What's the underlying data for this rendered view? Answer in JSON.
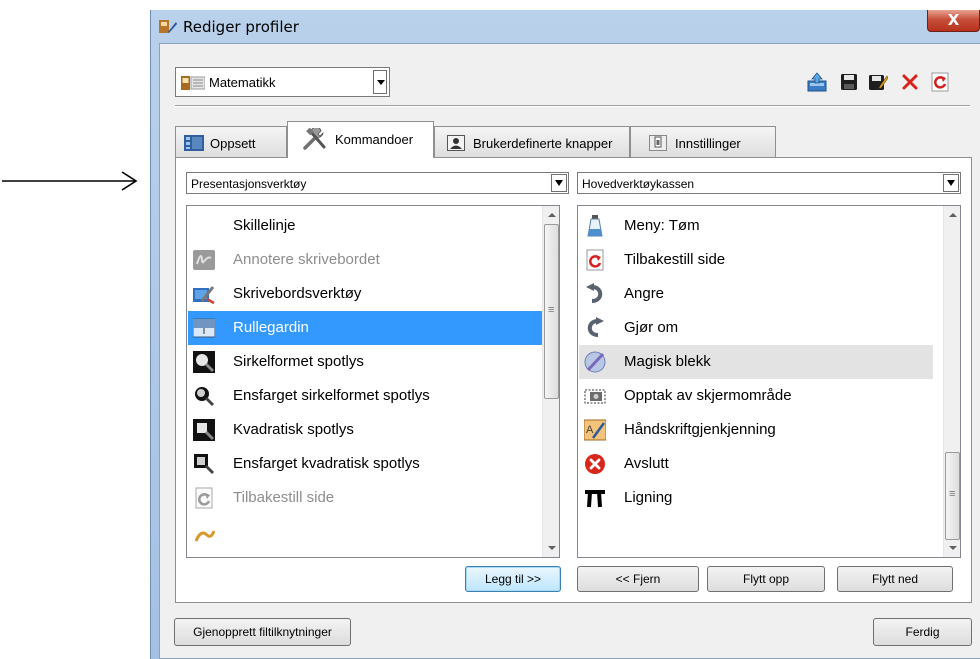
{
  "window": {
    "title": "Rediger profiler",
    "close_label": "X"
  },
  "profile": {
    "selected": "Matematikk"
  },
  "toolbar": {
    "icons": [
      "export-icon",
      "save-icon",
      "save-as-icon",
      "delete-icon",
      "reset-icon"
    ]
  },
  "tabs": [
    {
      "label": "Oppsett",
      "icon": "layout-icon"
    },
    {
      "label": "Kommandoer",
      "icon": "tools-icon",
      "active": true
    },
    {
      "label": "Brukerdefinerte knapper",
      "icon": "custom-button-icon"
    },
    {
      "label": "Innstillinger",
      "icon": "settings-icon"
    }
  ],
  "left": {
    "dropdown": "Presentasjonsverktøy",
    "items": [
      {
        "label": "Skillelinje",
        "icon": "",
        "state": "normal"
      },
      {
        "label": "Annotere skrivebordet",
        "icon": "annotate-icon",
        "state": "disabled"
      },
      {
        "label": "Skrivebordsverktøy",
        "icon": "desktop-tools-icon",
        "state": "normal"
      },
      {
        "label": "Rullegardin",
        "icon": "reveal-screen-icon",
        "state": "selected"
      },
      {
        "label": "Sirkelformet spotlys",
        "icon": "circle-spotlight-icon",
        "state": "normal"
      },
      {
        "label": "Ensfarget sirkelformet spotlys",
        "icon": "solid-circle-spotlight-icon",
        "state": "normal"
      },
      {
        "label": "Kvadratisk spotlys",
        "icon": "square-spotlight-icon",
        "state": "normal"
      },
      {
        "label": "Ensfarget kvadratisk spotlys",
        "icon": "solid-square-spotlight-icon",
        "state": "normal"
      },
      {
        "label": "Tilbakestill side",
        "icon": "reset-page-icon",
        "state": "disabled"
      },
      {
        "label": "",
        "icon": "partial-icon",
        "state": "partial"
      }
    ]
  },
  "right": {
    "dropdown": "Hovedverktøykassen",
    "items": [
      {
        "label": "Meny: Tøm",
        "icon": "clear-icon",
        "state": "normal"
      },
      {
        "label": "Tilbakestill side",
        "icon": "reset-page-icon",
        "state": "normal"
      },
      {
        "label": "Angre",
        "icon": "undo-icon",
        "state": "normal"
      },
      {
        "label": "Gjør om",
        "icon": "redo-icon",
        "state": "normal"
      },
      {
        "label": "Magisk blekk",
        "icon": "magic-ink-icon",
        "state": "hover"
      },
      {
        "label": "Opptak av skjermområde",
        "icon": "screen-capture-icon",
        "state": "normal"
      },
      {
        "label": "Håndskriftgjenkjenning",
        "icon": "handwriting-icon",
        "state": "normal"
      },
      {
        "label": "Avslutt",
        "icon": "exit-icon",
        "state": "normal"
      },
      {
        "label": "Ligning",
        "icon": "pi-icon",
        "state": "normal"
      }
    ]
  },
  "buttons": {
    "add": "Legg til >>",
    "remove": "<< Fjern",
    "move_up": "Flytt opp",
    "move_down": "Flytt ned",
    "restore": "Gjenopprett filtilknytninger",
    "done": "Ferdig"
  },
  "colors": {
    "selection": "#3399ff",
    "hover": "#e3e3e3",
    "disabled_text": "#8d8d8d"
  }
}
